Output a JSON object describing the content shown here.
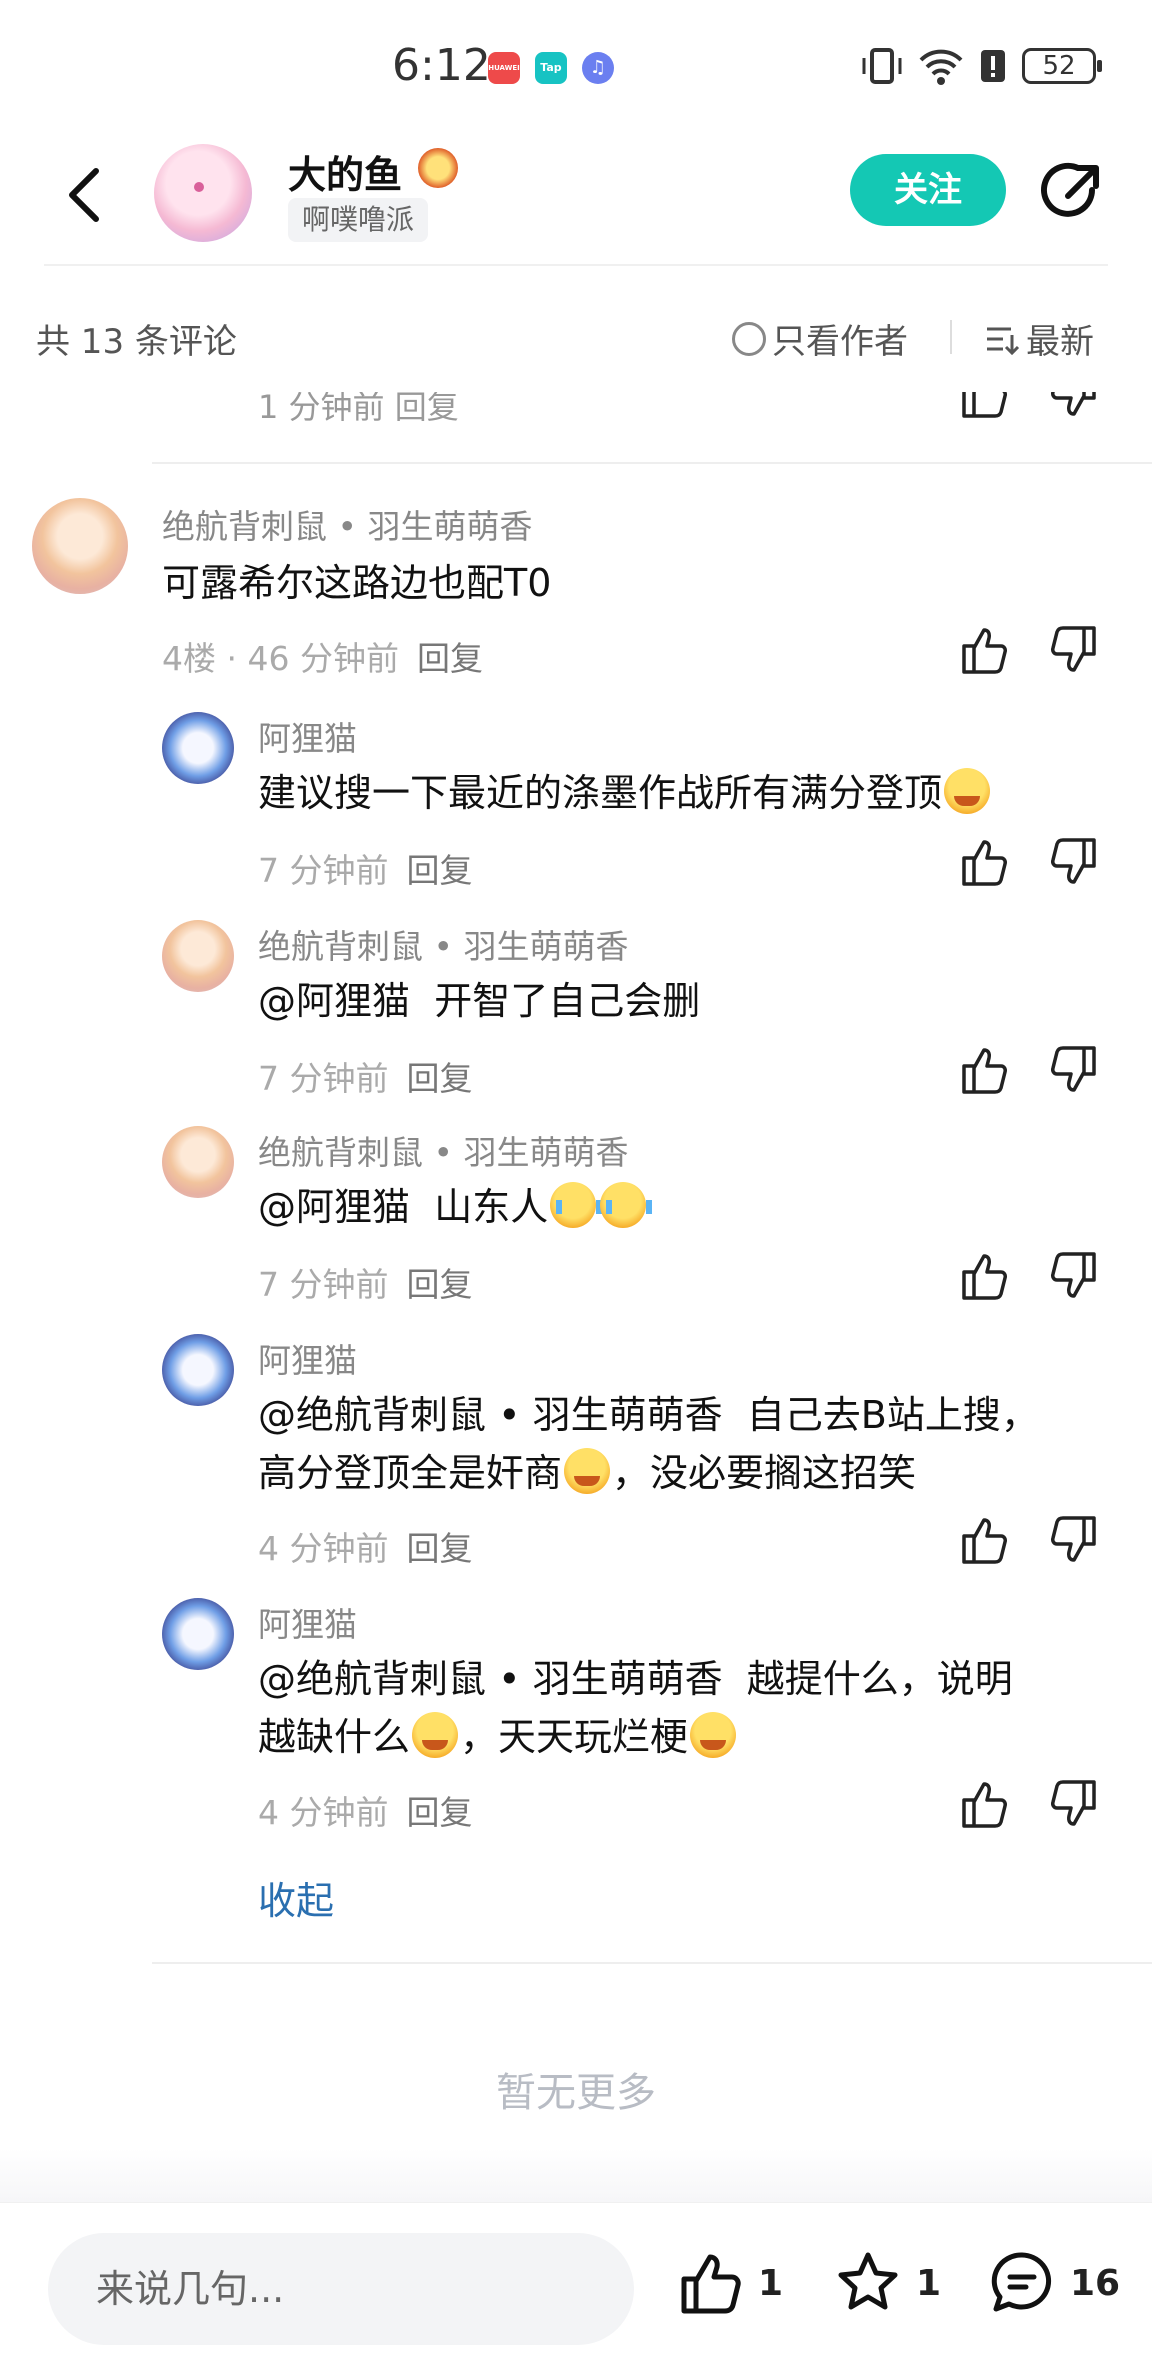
{
  "status_bar": {
    "time": "6:12",
    "badges": [
      {
        "label": "HUAWEI",
        "color": "#ee4a4a"
      },
      {
        "label": "Tap",
        "color": "#17c3c3"
      },
      {
        "label": "♫",
        "color": "#6b7ff0"
      }
    ],
    "battery": "52"
  },
  "header": {
    "author_name": "大的鱼",
    "author_tag": "啊噗噜派",
    "follow_label": "关注"
  },
  "comment_bar": {
    "count_text": "共 13 条评论",
    "only_author_label": "只看作者",
    "sort_label": "最新"
  },
  "partial_prev": {
    "meta": "1 分钟前  回复"
  },
  "comments": [
    {
      "name": "绝航背刺鼠 • 羽生萌萌香",
      "text": "可露希尔这路边也配T0",
      "meta": "4楼 · 46 分钟前",
      "reply": "回复",
      "avatar": "girl"
    },
    {
      "name": "阿狸猫",
      "text": "建议搜一下最近的涤墨作战所有满分登顶",
      "meta": "7 分钟前",
      "reply": "回复",
      "avatar": "cat"
    },
    {
      "name": "绝航背刺鼠 • 羽生萌萌香",
      "mention": "@阿狸猫",
      "text": "开智了自己会删",
      "meta": "7 分钟前",
      "reply": "回复",
      "avatar": "girl"
    },
    {
      "name": "绝航背刺鼠 • 羽生萌萌香",
      "mention": "@阿狸猫",
      "text": "山东人",
      "meta": "7 分钟前",
      "reply": "回复",
      "avatar": "girl"
    },
    {
      "name": "阿狸猫",
      "mention": "@绝航背刺鼠 • 羽生萌萌香",
      "text_line1": "自己去B站上搜，",
      "text_line2a": "高分登顶全是奸商",
      "text_line2b": "，没必要搁这招笑",
      "meta": "4 分钟前",
      "reply": "回复",
      "avatar": "cat"
    },
    {
      "name": "阿狸猫",
      "mention": "@绝航背刺鼠 • 羽生萌萌香",
      "text_line1": "越提什么，说明",
      "text_line2a": "越缺什么",
      "text_line2b": "，天天玩烂梗",
      "meta": "4 分钟前",
      "reply": "回复",
      "avatar": "cat"
    }
  ],
  "collapse_label": "收起",
  "no_more_label": "暂无更多",
  "bottom_bar": {
    "input_placeholder": "来说几句...",
    "like_count": "1",
    "star_count": "1",
    "comment_count": "16"
  },
  "colors": {
    "accent": "#14c8b4",
    "link": "#2a6fb0"
  }
}
